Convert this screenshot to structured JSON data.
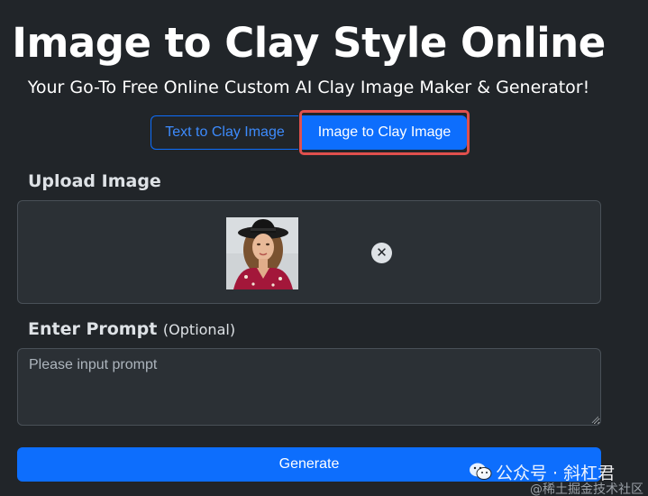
{
  "header": {
    "title": "Image to Clay Style Online",
    "subtitle": "Your Go-To Free Online Custom AI Clay Image Maker & Generator!"
  },
  "tabs": [
    {
      "label": "Text to Clay Image",
      "active": false
    },
    {
      "label": "Image to Clay Image",
      "active": true
    }
  ],
  "upload": {
    "label": "Upload Image",
    "remove_icon": "close-icon"
  },
  "prompt": {
    "label": "Enter Prompt",
    "optional": "(Optional)",
    "placeholder": "Please input prompt",
    "value": ""
  },
  "generate_label": "Generate",
  "watermark": {
    "line1": "公众号 · 斜杠君",
    "line2": "@稀土掘金技术社区"
  },
  "colors": {
    "background": "#212529",
    "accent": "#0d6efd",
    "highlight": "#e0504d"
  }
}
